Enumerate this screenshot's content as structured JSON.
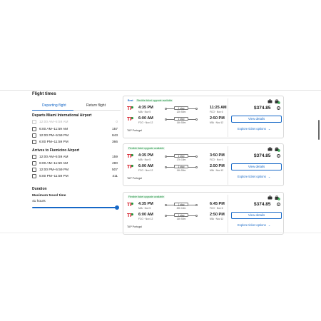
{
  "filters": {
    "title": "Flight times",
    "tabs": [
      "Departing flight",
      "Return flight"
    ],
    "departs_title": "Departs Miami International Airport",
    "departs": [
      {
        "label": "12:00 AM–5:59 AM",
        "count": "0",
        "disabled": true
      },
      {
        "label": "6:00 AM–11:59 AM",
        "count": "157",
        "disabled": false
      },
      {
        "label": "12:00 PM–5:59 PM",
        "count": "843",
        "disabled": false
      },
      {
        "label": "6:00 PM–11:59 PM",
        "count": "366",
        "disabled": false
      }
    ],
    "arrives_title": "Arrives to Fiumicino Airport",
    "arrives": [
      {
        "label": "12:00 AM–5:59 AM",
        "count": "159"
      },
      {
        "label": "6:00 AM–11:59 AM",
        "count": "490"
      },
      {
        "label": "12:00 PM–5:59 PM",
        "count": "507"
      },
      {
        "label": "6:00 PM–11:59 PM",
        "count": "411"
      }
    ],
    "duration_title": "Duration",
    "max_travel_label": "Maximum travel time",
    "max_travel_value": "41 hours",
    "slider_level": 1.0
  },
  "accent_color": "#1668c7",
  "flights": [
    {
      "best": "Best",
      "flex": "Flexible ticket upgrade available",
      "legs": [
        {
          "dep_time": "4:35 PM",
          "dep_sub": "MIA · Nov 5",
          "stops": "1 stop",
          "duration": "12h 50m",
          "arr_time": "11:25 AM",
          "arr_sub": "FCO · Nov 6"
        },
        {
          "dep_time": "6:00 AM",
          "dep_sub": "FCO · Nov 12",
          "stops": "1 stop",
          "duration": "14h 50m",
          "arr_time": "2:50 PM",
          "arr_sub": "MIA · Nov 12"
        }
      ],
      "carrier": "TAP Portugal",
      "price": "$374.85",
      "view_label": "View details",
      "explore_label": "Explore ticket options"
    },
    {
      "best": "",
      "flex": "Flexible ticket upgrade available",
      "legs": [
        {
          "dep_time": "4:35 PM",
          "dep_sub": "MIA · Nov 5",
          "stops": "1 stop",
          "duration": "17h 15m",
          "arr_time": "3:50 PM",
          "arr_sub": "FCO · Nov 6"
        },
        {
          "dep_time": "6:00 AM",
          "dep_sub": "FCO · Nov 12",
          "stops": "1 stop",
          "duration": "14h 50m",
          "arr_time": "2:50 PM",
          "arr_sub": "MIA · Nov 12"
        }
      ],
      "carrier": "TAP Portugal",
      "price": "$374.85",
      "view_label": "View details",
      "explore_label": "Explore ticket options"
    },
    {
      "best": "",
      "flex": "Flexible ticket upgrade available",
      "legs": [
        {
          "dep_time": "4:35 PM",
          "dep_sub": "MIA · Nov 5",
          "stops": "1 stop",
          "duration": "20h 10m",
          "arr_time": "6:45 PM",
          "arr_sub": "FCO · Nov 6"
        },
        {
          "dep_time": "6:00 AM",
          "dep_sub": "FCO · Nov 12",
          "stops": "1 stop",
          "duration": "14h 50m",
          "arr_time": "2:50 PM",
          "arr_sub": "MIA · Nov 12"
        }
      ],
      "carrier": "TAP Portugal",
      "price": "$374.85",
      "view_label": "View details",
      "explore_label": "Explore ticket options"
    }
  ]
}
